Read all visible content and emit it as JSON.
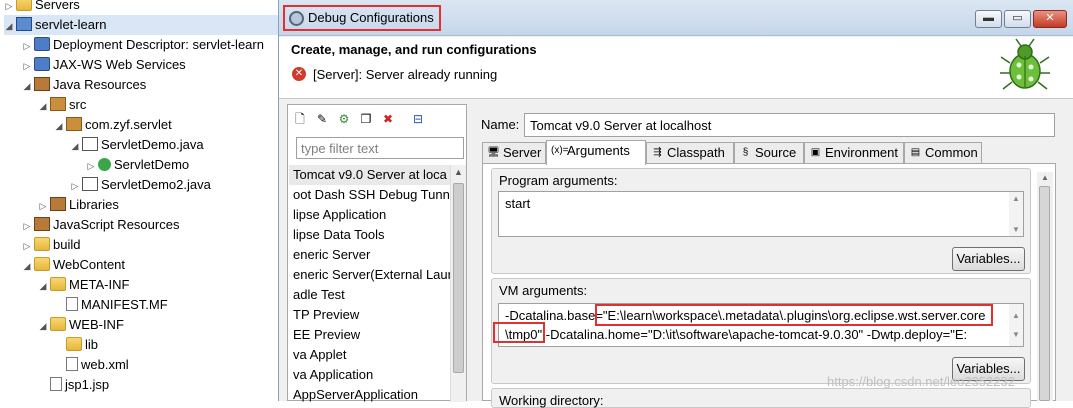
{
  "explorer": {
    "items": [
      {
        "label": "Servers",
        "icon": "folder-icon",
        "arrow": "▷"
      },
      {
        "label": "servlet-learn",
        "icon": "project-icon",
        "arrow": "◢"
      },
      {
        "label": "Deployment Descriptor: servlet-learn",
        "icon": "web-descriptor-icon",
        "arrow": "▷"
      },
      {
        "label": "JAX-WS Web Services",
        "icon": "web-services-icon",
        "arrow": "▷"
      },
      {
        "label": "Java Resources",
        "icon": "java-resources-icon",
        "arrow": "◢"
      },
      {
        "label": "src",
        "icon": "source-folder-icon",
        "arrow": "◢"
      },
      {
        "label": "com.zyf.servlet",
        "icon": "package-icon",
        "arrow": "◢"
      },
      {
        "label": "ServletDemo.java",
        "icon": "java-file-icon",
        "arrow": "◢"
      },
      {
        "label": "ServletDemo",
        "icon": "class-icon",
        "arrow": "▷"
      },
      {
        "label": "ServletDemo2.java",
        "icon": "java-file-icon",
        "arrow": "▷"
      },
      {
        "label": "Libraries",
        "icon": "library-icon",
        "arrow": "▷"
      },
      {
        "label": "JavaScript Resources",
        "icon": "javascript-icon",
        "arrow": "▷"
      },
      {
        "label": "build",
        "icon": "folder-icon",
        "arrow": "▷"
      },
      {
        "label": "WebContent",
        "icon": "folder-icon",
        "arrow": "◢"
      },
      {
        "label": "META-INF",
        "icon": "folder-icon",
        "arrow": "◢"
      },
      {
        "label": "MANIFEST.MF",
        "icon": "file-icon",
        "arrow": ""
      },
      {
        "label": "WEB-INF",
        "icon": "folder-icon",
        "arrow": "◢"
      },
      {
        "label": "lib",
        "icon": "folder-icon",
        "arrow": ""
      },
      {
        "label": "web.xml",
        "icon": "xml-file-icon",
        "arrow": ""
      },
      {
        "label": "jsp1.jsp",
        "icon": "jsp-file-icon",
        "arrow": ""
      }
    ]
  },
  "dialog": {
    "title": "Debug Configurations",
    "header_title": "Create, manage, and run configurations",
    "header_message": "[Server]: Server already running",
    "filter_placeholder": "type filter text",
    "configs": [
      "Tomcat v9.0 Server at loca",
      "oot Dash SSH Debug Tunne",
      "lipse Application",
      "lipse Data Tools",
      "eneric Server",
      "eneric Server(External Laun",
      "adle Test",
      "TP Preview",
      "EE Preview",
      "va Applet",
      "va Application",
      "AppServerApplication"
    ],
    "name_label": "Name:",
    "name_value": "Tomcat v9.0 Server at localhost",
    "tabs": [
      "Server",
      "Arguments",
      "Classpath",
      "Source",
      "Environment",
      "Common"
    ],
    "program_args_label": "Program arguments:",
    "program_args_value": "start",
    "variables_label": "Variables...",
    "vm_args_label": "VM arguments:",
    "vm_line1_prefix": "-Dcatalina.base=",
    "vm_line1_highlight": "\"E:\\learn\\workspace\\.metadata\\.plugins\\org.eclipse.wst.server.core",
    "vm_line2_highlight": "\\tmp0\"",
    "vm_line2_rest": " -Dcatalina.home=\"D:\\it\\software\\apache-tomcat-9.0.30\" -Dwtp.deploy=\"E:",
    "working_dir_label": "Working directory:",
    "window_buttons": {
      "minimize": "▬",
      "maximize": "▭",
      "close": "✕"
    }
  },
  "watermark": "https://blog.csdn.net/leo2352232"
}
